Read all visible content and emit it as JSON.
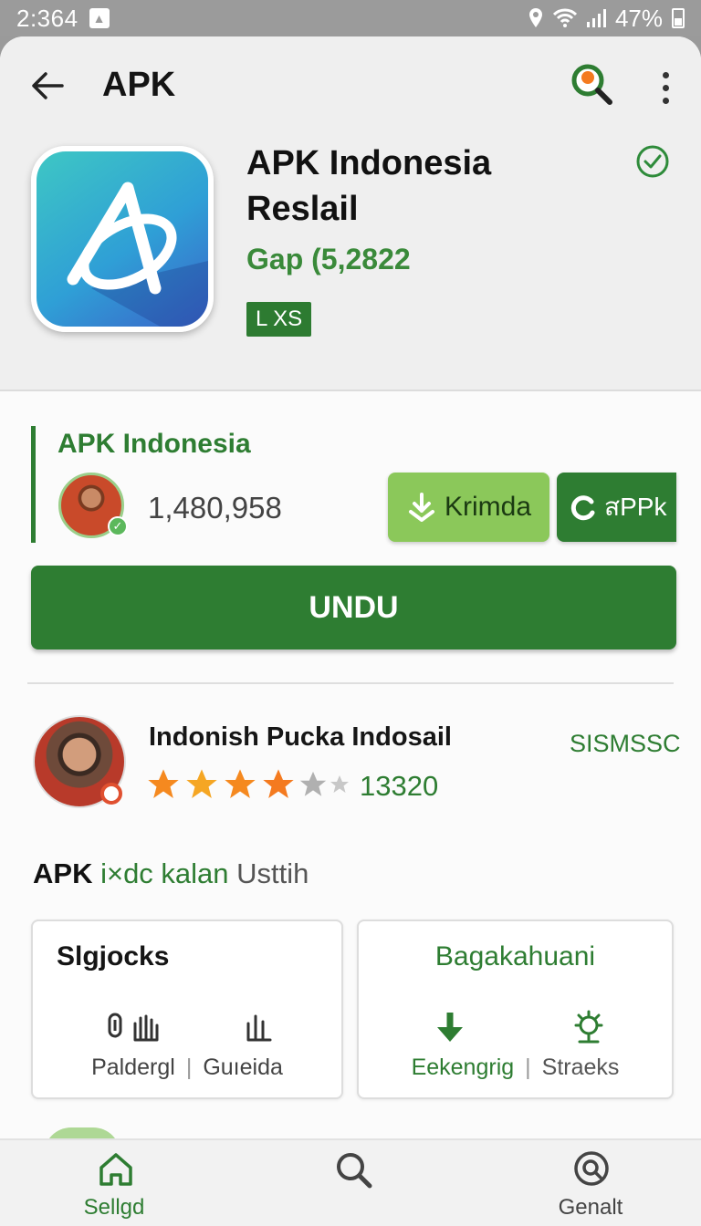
{
  "status_bar": {
    "time": "2:364",
    "battery": "47%",
    "icons": [
      "gallery-notification-icon",
      "location-icon",
      "wifi-icon",
      "signal-icon",
      "battery-icon"
    ]
  },
  "toolbar": {
    "title": "APK",
    "icons": [
      "back-arrow-icon",
      "search-icon",
      "more-vert-icon"
    ]
  },
  "app": {
    "name": "APK Indonesia Reslail",
    "subtitle": "Gap (5,2822",
    "badge": "L XS",
    "icon": "app-logo-icon",
    "verified_icon": "check-circle-icon"
  },
  "developer": {
    "name": "APK Indonesia",
    "count": "1,480,958",
    "button_primary": "Krimda",
    "button_secondary": "สPPk"
  },
  "install_button": "UNDU",
  "review": {
    "title": "Indonish Pucka Indosail",
    "rating": 4,
    "rating_max": 5,
    "count": "13320",
    "link": "SISMSSC"
  },
  "section": {
    "part1": "APK",
    "part2": "i×dc kalan",
    "part3": "Usttih"
  },
  "cards": {
    "left": {
      "title": "Slgjocks",
      "label1": "Paldergl",
      "label2": "Guıeida",
      "icons": [
        "paperclip-icon",
        "hand-icon",
        "hand-outline-icon"
      ]
    },
    "right": {
      "title": "Bagakahuani",
      "label1": "Eekengrig",
      "label2": "Straeks",
      "icons": [
        "download-arrow-icon",
        "gear-sun-icon"
      ]
    }
  },
  "bottom_nav": {
    "home_label": "Sellgd",
    "genalt_label": "Genalt",
    "icons": [
      "home-icon",
      "search-icon",
      "search-circle-icon"
    ]
  },
  "colors": {
    "accent_green": "#2e7d32",
    "light_green": "#8bc85a",
    "star_orange": "#f5a623"
  }
}
